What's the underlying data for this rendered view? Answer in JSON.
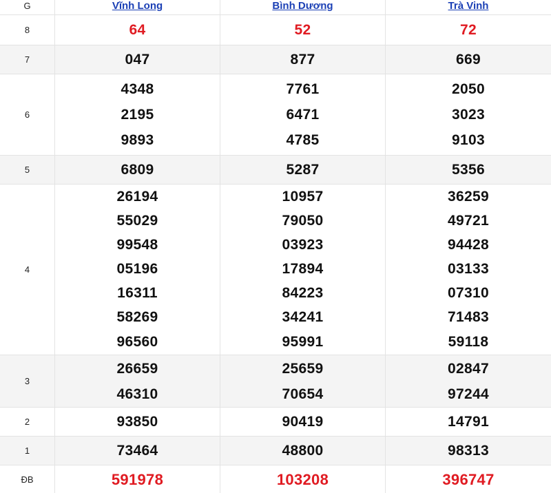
{
  "header": {
    "g_label": "G",
    "provinces": [
      "Vĩnh Long",
      "Bình Dương",
      "Trà Vinh"
    ]
  },
  "prizes": [
    {
      "label": "8",
      "values": [
        [
          "64"
        ],
        [
          "52"
        ],
        [
          "72"
        ]
      ],
      "highlight": true
    },
    {
      "label": "7",
      "values": [
        [
          "047"
        ],
        [
          "877"
        ],
        [
          "669"
        ]
      ]
    },
    {
      "label": "6",
      "values": [
        [
          "4348",
          "2195",
          "9893"
        ],
        [
          "7761",
          "6471",
          "4785"
        ],
        [
          "2050",
          "3023",
          "9103"
        ]
      ]
    },
    {
      "label": "5",
      "values": [
        [
          "6809"
        ],
        [
          "5287"
        ],
        [
          "5356"
        ]
      ]
    },
    {
      "label": "4",
      "values": [
        [
          "26194",
          "55029",
          "99548",
          "05196",
          "16311",
          "58269",
          "96560"
        ],
        [
          "10957",
          "79050",
          "03923",
          "17894",
          "84223",
          "34241",
          "95991"
        ],
        [
          "36259",
          "49721",
          "94428",
          "03133",
          "07310",
          "71483",
          "59118"
        ]
      ]
    },
    {
      "label": "3",
      "values": [
        [
          "26659",
          "46310"
        ],
        [
          "25659",
          "70654"
        ],
        [
          "02847",
          "97244"
        ]
      ]
    },
    {
      "label": "2",
      "values": [
        [
          "93850"
        ],
        [
          "90419"
        ],
        [
          "14791"
        ]
      ]
    },
    {
      "label": "1",
      "values": [
        [
          "73464"
        ],
        [
          "48800"
        ],
        [
          "98313"
        ]
      ]
    },
    {
      "label": "ĐB",
      "values": [
        [
          "591978"
        ],
        [
          "103208"
        ],
        [
          "396747"
        ]
      ],
      "highlight": true
    }
  ],
  "colors": {
    "highlight": "#e01b22",
    "link": "#1a3fb5",
    "alt_row": "#f4f4f4"
  }
}
